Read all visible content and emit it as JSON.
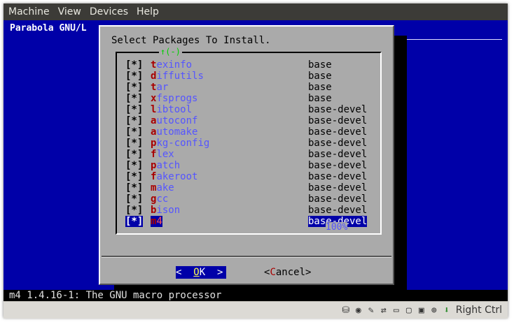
{
  "menubar": {
    "items": [
      "Machine",
      "View",
      "Devices",
      "Help"
    ]
  },
  "screen": {
    "title": "Parabola GNU/L",
    "dialog": {
      "title": "Select Packages To Install.",
      "scroll_indicator": "↑(-)",
      "scroll_percent": "100%",
      "packages": [
        {
          "check": "[*]",
          "hotkey": "t",
          "rest": "exinfo",
          "group": "base"
        },
        {
          "check": "[*]",
          "hotkey": "d",
          "rest": "iffutils",
          "group": "base"
        },
        {
          "check": "[*]",
          "hotkey": "t",
          "rest": "ar",
          "group": "base"
        },
        {
          "check": "[*]",
          "hotkey": "x",
          "rest": "fsprogs",
          "group": "base"
        },
        {
          "check": "[*]",
          "hotkey": "l",
          "rest": "ibtool",
          "group": "base-devel"
        },
        {
          "check": "[*]",
          "hotkey": "a",
          "rest": "utoconf",
          "group": "base-devel"
        },
        {
          "check": "[*]",
          "hotkey": "a",
          "rest": "utomake",
          "group": "base-devel"
        },
        {
          "check": "[*]",
          "hotkey": "p",
          "rest": "kg-config",
          "group": "base-devel"
        },
        {
          "check": "[*]",
          "hotkey": "f",
          "rest": "lex",
          "group": "base-devel"
        },
        {
          "check": "[*]",
          "hotkey": "p",
          "rest": "atch",
          "group": "base-devel"
        },
        {
          "check": "[*]",
          "hotkey": "f",
          "rest": "akeroot",
          "group": "base-devel"
        },
        {
          "check": "[*]",
          "hotkey": "m",
          "rest": "ake",
          "group": "base-devel"
        },
        {
          "check": "[*]",
          "hotkey": "g",
          "rest": "cc",
          "group": "base-devel"
        },
        {
          "check": "[*]",
          "hotkey": "b",
          "rest": "ison",
          "group": "base-devel"
        },
        {
          "check": "[*]",
          "hotkey": "m",
          "rest": "4",
          "group": "base-devel",
          "selected": true
        }
      ],
      "ok_button": {
        "left": "<  ",
        "hotkey": "O",
        "rest": "K",
        "right": "  >"
      },
      "cancel_button": {
        "left": "<",
        "hotkey": "C",
        "rest": "ancel",
        "right": ">"
      }
    },
    "status_line": "m4 1.4.16-1: The GNU macro processor"
  },
  "vbox_status": {
    "icons": [
      "hard-disk-icon",
      "optical-disk-icon",
      "usb-icon",
      "network-icon",
      "shared-folder-icon",
      "display-icon",
      "capture-icon",
      "mouse-integration-icon"
    ],
    "host_key": "Right Ctrl"
  }
}
